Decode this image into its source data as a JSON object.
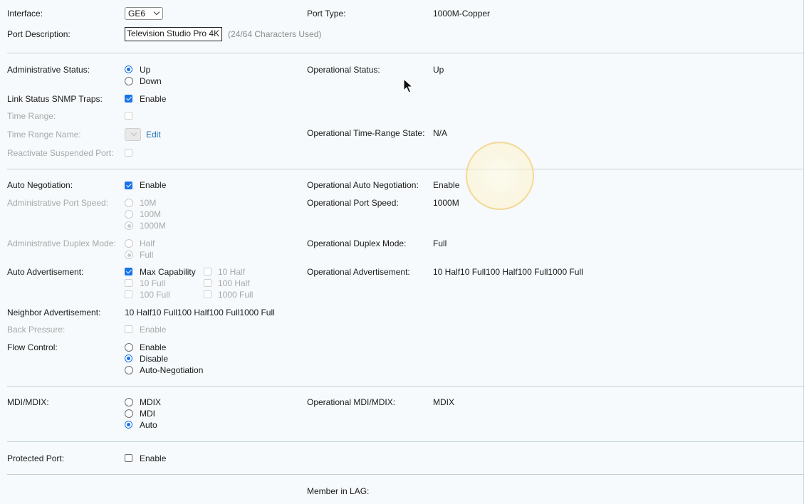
{
  "top": {
    "interface_label": "Interface:",
    "interface_value": "GE6",
    "port_type_label": "Port Type:",
    "port_type_value": "1000M-Copper",
    "port_desc_label": "Port Description:",
    "port_desc_value": "Television Studio Pro 4K",
    "port_desc_hint": "(24/64 Characters Used)"
  },
  "admin": {
    "admin_status_label": "Administrative Status:",
    "admin_status_options": [
      "Up",
      "Down"
    ],
    "admin_status_selected": "Up",
    "oper_status_label": "Operational Status:",
    "oper_status_value": "Up",
    "snmp_label": "Link Status SNMP Traps:",
    "snmp_option": "Enable",
    "snmp_checked": true,
    "time_range_label": "Time Range:",
    "time_range_name_label": "Time Range Name:",
    "edit_link": "Edit",
    "oper_time_range_label": "Operational Time-Range State:",
    "oper_time_range_value": "N/A",
    "reactivate_label": "Reactivate Suspended Port:"
  },
  "negotiation": {
    "auto_neg_label": "Auto Negotiation:",
    "auto_neg_option": "Enable",
    "auto_neg_checked": true,
    "oper_auto_neg_label": "Operational Auto Negotiation:",
    "oper_auto_neg_value": "Enable",
    "port_speed_label": "Administrative Port Speed:",
    "port_speed_options": [
      "10M",
      "100M",
      "1000M"
    ],
    "port_speed_selected": "1000M",
    "oper_port_speed_label": "Operational Port Speed:",
    "oper_port_speed_value": "1000M",
    "duplex_label": "Administrative Duplex Mode:",
    "duplex_options": [
      "Half",
      "Full"
    ],
    "duplex_selected": "Full",
    "oper_duplex_label": "Operational Duplex Mode:",
    "oper_duplex_value": "Full",
    "auto_adv_label": "Auto Advertisement:",
    "auto_adv_options": {
      "max_capability": "Max Capability",
      "half_10": "10 Half",
      "full_10": "10 Full",
      "half_100": "100 Half",
      "full_100": "100 Full",
      "full_1000": "1000 Full"
    },
    "auto_adv_checked": "Max Capability",
    "oper_adv_label": "Operational Advertisement:",
    "oper_adv_value": "10 Half10 Full100 Half100 Full1000 Full",
    "neighbor_adv_label": "Neighbor Advertisement:",
    "neighbor_adv_value": "10 Half10 Full100 Half100 Full1000 Full",
    "back_pressure_label": "Back Pressure:",
    "back_pressure_option": "Enable",
    "flow_control_label": "Flow Control:",
    "flow_control_options": [
      "Enable",
      "Disable",
      "Auto-Negotiation"
    ],
    "flow_control_selected": "Disable"
  },
  "mdi": {
    "label": "MDI/MDIX:",
    "options": [
      "MDIX",
      "MDI",
      "Auto"
    ],
    "selected": "Auto",
    "oper_label": "Operational MDI/MDIX:",
    "oper_value": "MDIX"
  },
  "protected": {
    "label": "Protected Port:",
    "option": "Enable",
    "checked": false
  },
  "lag": {
    "label": "Member in LAG:"
  },
  "colors": {
    "accent": "#1a73e8",
    "background": "#f6fafc",
    "link": "#1a6db5"
  },
  "icons": [
    "chevron-down-icon",
    "mouse-pointer-icon",
    "cursor-highlight-icon"
  ]
}
